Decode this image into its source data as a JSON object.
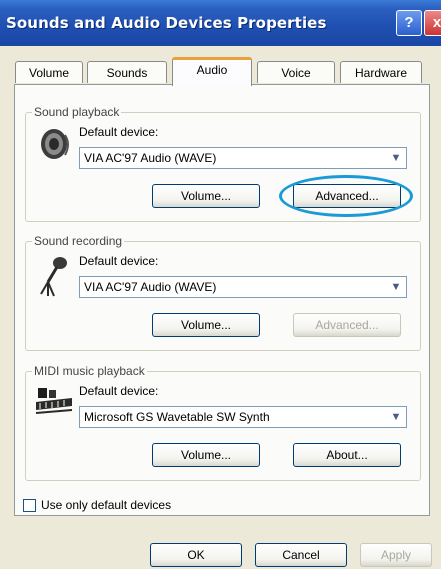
{
  "window": {
    "title": "Sounds and Audio Devices Properties",
    "help_glyph": "?",
    "close_glyph": "x"
  },
  "tabs": [
    {
      "label": "Volume"
    },
    {
      "label": "Sounds"
    },
    {
      "label": "Audio"
    },
    {
      "label": "Voice"
    },
    {
      "label": "Hardware"
    }
  ],
  "playback": {
    "group_label": "Sound playback",
    "device_label": "Default device:",
    "device_value": "VIA AC'97 Audio (WAVE)",
    "volume_label": "Volume...",
    "advanced_label": "Advanced..."
  },
  "recording": {
    "group_label": "Sound recording",
    "device_label": "Default device:",
    "device_value": "VIA AC'97 Audio (WAVE)",
    "volume_label": "Volume...",
    "advanced_label": "Advanced..."
  },
  "midi": {
    "group_label": "MIDI music playback",
    "device_label": "Default device:",
    "device_value": "Microsoft GS Wavetable SW Synth",
    "volume_label": "Volume...",
    "about_label": "About..."
  },
  "options": {
    "default_only_label": "Use only default devices",
    "default_only_checked": false
  },
  "footer": {
    "ok_label": "OK",
    "cancel_label": "Cancel",
    "apply_label": "Apply"
  },
  "dropdown_arrow": "▼",
  "colors": {
    "highlight_ring": "#1a9ad6",
    "title_bar": "#1f4fb0",
    "active_tab_accent": "#e8a23a"
  }
}
